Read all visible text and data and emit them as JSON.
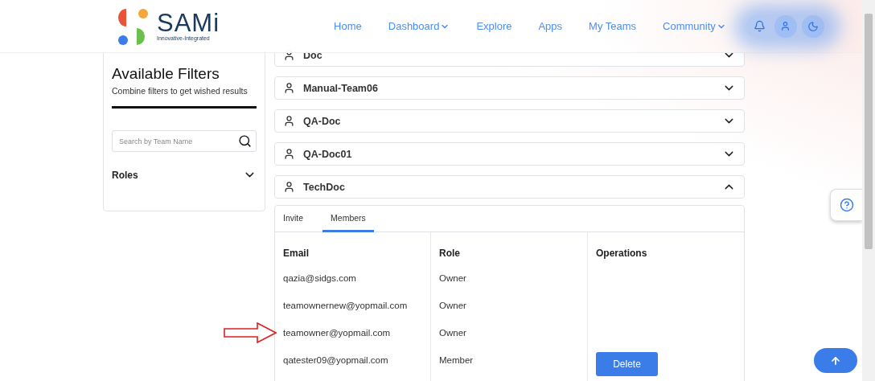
{
  "logo": {
    "name": "SAMi",
    "tagline": "Innovative-Integrated"
  },
  "nav": [
    {
      "label": "Home",
      "dropdown": false
    },
    {
      "label": "Dashboard",
      "dropdown": true
    },
    {
      "label": "Explore",
      "dropdown": false
    },
    {
      "label": "Apps",
      "dropdown": false
    },
    {
      "label": "My Teams",
      "dropdown": false
    },
    {
      "label": "Community",
      "dropdown": true
    }
  ],
  "filters": {
    "title": "Available Filters",
    "subtitle": "Combine filters to get wished results",
    "search": {
      "placeholder": "Search by Team Name"
    },
    "sections": [
      {
        "label": "Roles",
        "expanded": false
      }
    ]
  },
  "teams": [
    {
      "name": "Doc",
      "expanded": false
    },
    {
      "name": "Manual-Team06",
      "expanded": false
    },
    {
      "name": "QA-Doc",
      "expanded": false
    },
    {
      "name": "QA-Doc01",
      "expanded": false
    },
    {
      "name": "TechDoc",
      "expanded": true
    }
  ],
  "members_panel": {
    "tabs": [
      {
        "label": "Invite",
        "selected": false
      },
      {
        "label": "Members",
        "selected": true
      }
    ],
    "columns": [
      "Email",
      "Role",
      "Operations"
    ],
    "rows": [
      {
        "email": "qazia@sidgs.com",
        "role": "Owner",
        "highlighted": false
      },
      {
        "email": "teamownernew@yopmail.com",
        "role": "Owner",
        "highlighted": false
      },
      {
        "email": "teamowner@yopmail.com",
        "role": "Owner",
        "highlighted": true
      },
      {
        "email": "qatester09@yopmail.com",
        "role": "Member",
        "highlighted": false,
        "operation": "Delete"
      }
    ]
  }
}
